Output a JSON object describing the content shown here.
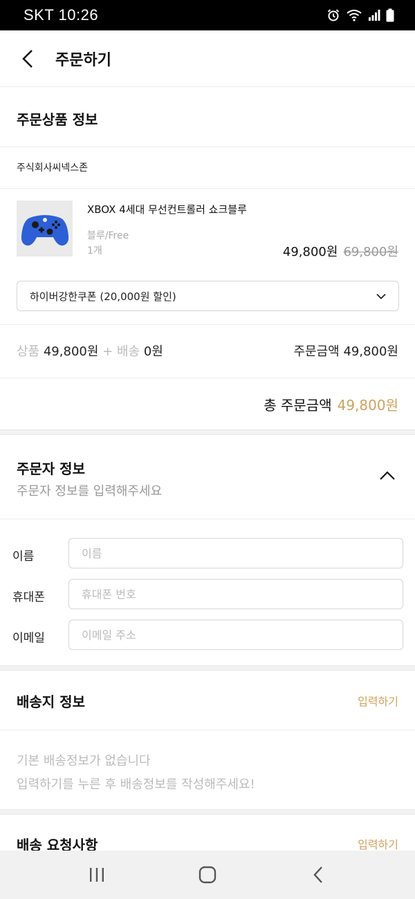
{
  "status_bar": {
    "carrier_time": "SKT 10:26"
  },
  "header": {
    "title": "주문하기"
  },
  "order_product": {
    "section_title": "주문상품 정보",
    "seller": "주식회사씨넥스존",
    "product": {
      "name": "XBOX 4세대 무선컨트롤러 쇼크블루",
      "option": "블루/Free",
      "quantity": "1개",
      "price": "49,800원",
      "original_price": "69,800원"
    },
    "coupon": {
      "selected": "하이버강한쿠폰 (20,000원 할인)"
    },
    "summary": {
      "product_label": "상품",
      "product_amount": "49,800원",
      "plus": "+",
      "shipping_label": "배송",
      "shipping_amount": "0원",
      "order_amount_label": "주문금액",
      "order_amount": "49,800원"
    },
    "total": {
      "label": "총 주문금액",
      "amount": "49,800원"
    }
  },
  "orderer": {
    "title": "주문자 정보",
    "subtitle": "주문자 정보를 입력해주세요",
    "fields": [
      {
        "label": "이름",
        "placeholder": "이름",
        "value": ""
      },
      {
        "label": "휴대폰",
        "placeholder": "휴대폰 번호",
        "value": ""
      },
      {
        "label": "이메일",
        "placeholder": "이메일 주소",
        "value": ""
      }
    ]
  },
  "shipping": {
    "title": "배송지 정보",
    "action": "입력하기",
    "empty_line1": "기본 배송정보가 없습니다",
    "empty_line2": "입력하기를 누른 후 배송정보를 작성해주세요!"
  },
  "request": {
    "title": "배송 요청사항",
    "action": "입력하기"
  },
  "colors": {
    "accent": "#d1a15c",
    "controller_blue": "#2d5fd6",
    "status_bar": "#000000"
  },
  "icons": {
    "back": "chevron-left-icon",
    "coupon_dropdown": "chevron-down-icon",
    "collapse": "chevron-up-icon",
    "nav_recent": "recent-apps-icon",
    "nav_home": "home-icon",
    "nav_back": "back-icon"
  }
}
